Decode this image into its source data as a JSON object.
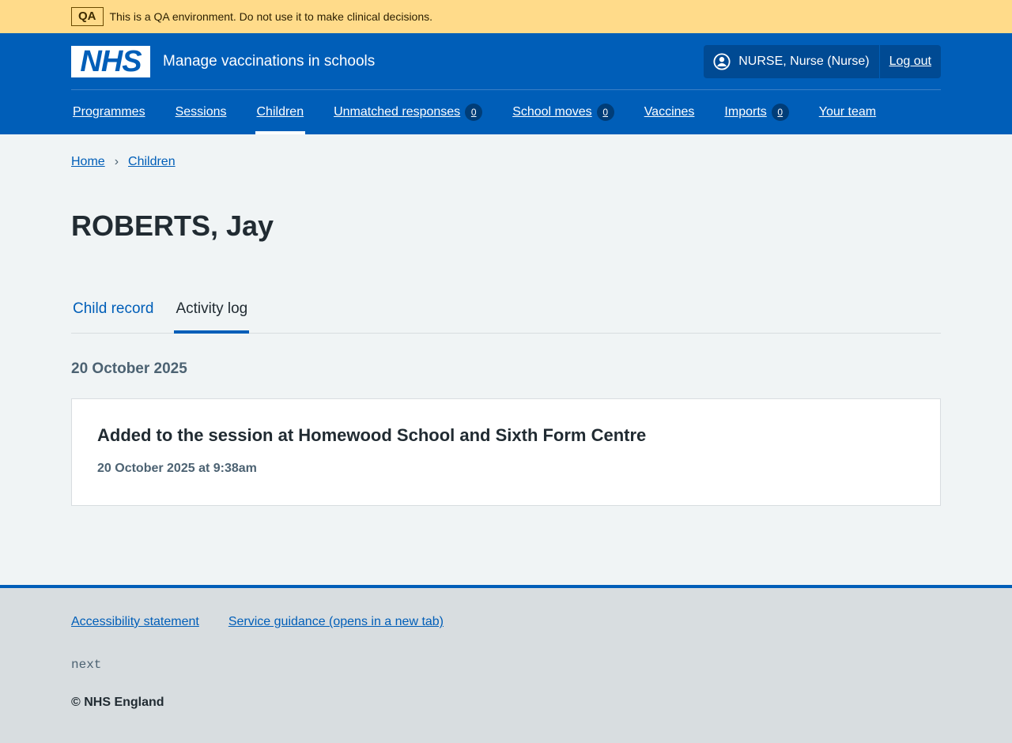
{
  "env_banner": {
    "tag": "QA",
    "text": "This is a QA environment. Do not use it to make clinical decisions."
  },
  "header": {
    "logo": "NHS",
    "service_name": "Manage vaccinations in schools",
    "user": "NURSE, Nurse (Nurse)",
    "logout": "Log out"
  },
  "nav": {
    "programmes": "Programmes",
    "sessions": "Sessions",
    "children": "Children",
    "unmatched": "Unmatched responses",
    "unmatched_count": "0",
    "school_moves": "School moves",
    "school_moves_count": "0",
    "vaccines": "Vaccines",
    "imports": "Imports",
    "imports_count": "0",
    "your_team": "Your team"
  },
  "breadcrumb": {
    "home": "Home",
    "children": "Children"
  },
  "page_title": "ROBERTS, Jay",
  "tabs": {
    "child_record": "Child record",
    "activity_log": "Activity log"
  },
  "activity": {
    "date_heading": "20 October 2025",
    "card_title": "Added to the session at Homewood School and Sixth Form Centre",
    "card_meta": "20 October 2025 at 9:38am"
  },
  "footer": {
    "accessibility": "Accessibility statement",
    "guidance": "Service guidance (opens in a new tab)",
    "env_name": "next",
    "copyright": "© NHS England"
  }
}
